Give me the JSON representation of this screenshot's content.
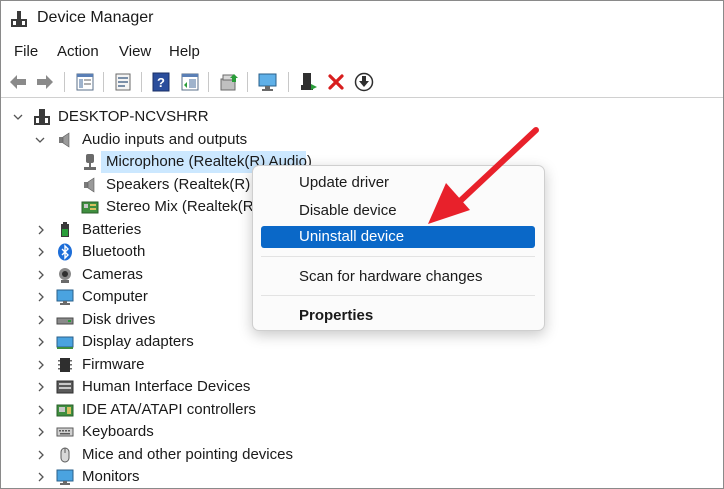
{
  "window": {
    "title": "Device Manager"
  },
  "menubar": {
    "items": [
      "File",
      "Action",
      "View",
      "Help"
    ]
  },
  "toolbar": {
    "buttons": [
      "back-icon",
      "forward-icon",
      "show-hide-tree-icon",
      "properties-icon",
      "help-icon",
      "view-icon",
      "update-driver-icon",
      "scan-icon",
      "enable-device-icon",
      "uninstall-icon",
      "download-icon"
    ]
  },
  "tree": {
    "root": "DESKTOP-NCVSHRR",
    "audio_group": {
      "label": "Audio inputs and outputs",
      "children": [
        "Microphone (Realtek(R) Audio)",
        "Speakers (Realtek(R) Au",
        "Stereo Mix (Realtek(R) A"
      ]
    },
    "categories": [
      "Batteries",
      "Bluetooth",
      "Cameras",
      "Computer",
      "Disk drives",
      "Display adapters",
      "Firmware",
      "Human Interface Devices",
      "IDE ATA/ATAPI controllers",
      "Keyboards",
      "Mice and other pointing devices",
      "Monitors"
    ]
  },
  "context_menu": {
    "items": [
      "Update driver",
      "Disable device",
      "Uninstall device",
      "Scan for hardware changes",
      "Properties"
    ],
    "highlighted": "Uninstall device"
  },
  "colors": {
    "highlight": "#0a68c8",
    "selection": "#cce8ff",
    "annotation_arrow": "#e8212b"
  }
}
